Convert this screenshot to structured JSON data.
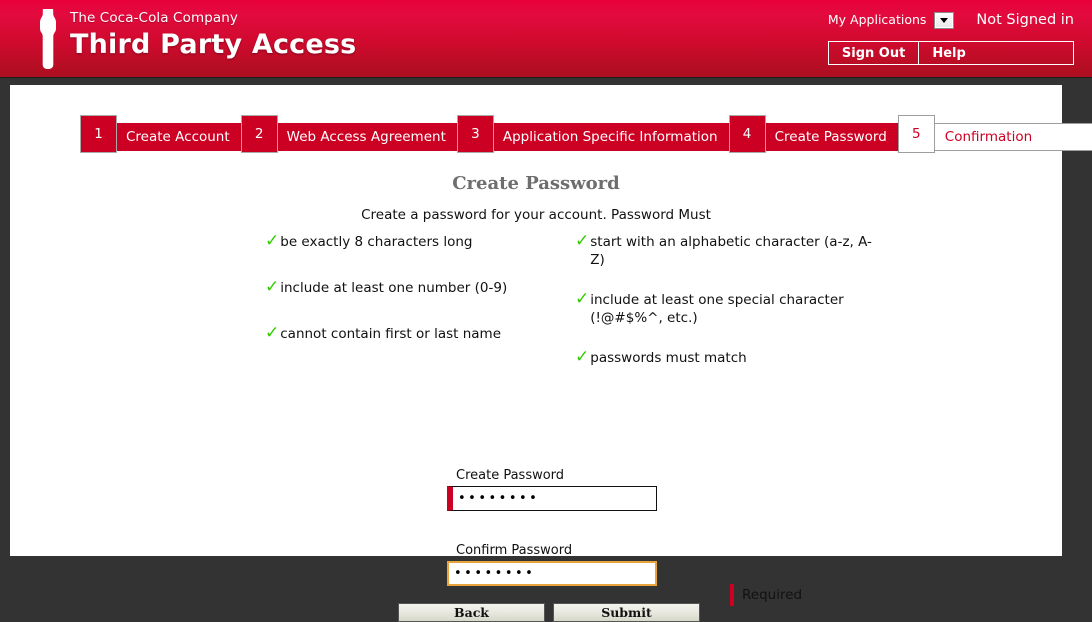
{
  "header": {
    "company": "The Coca-Cola Company",
    "app_title": "Third Party Access",
    "logo_icon": "coca-cola-bottle-icon",
    "apps_label": "My Applications",
    "apps_caret_icon": "chevron-down-icon",
    "sign_status": "Not Signed in",
    "sign_out_label": "Sign Out",
    "help_label": "Help",
    "brand_red": "#cc0022",
    "header_gradient_top": "#e8003c",
    "header_gradient_bottom": "#ab0f20"
  },
  "steps": [
    {
      "number": "1",
      "label": "Create Account",
      "state": "active"
    },
    {
      "number": "2",
      "label": "Web Access Agreement",
      "state": "active"
    },
    {
      "number": "3",
      "label": "Application Specific Information",
      "state": "active"
    },
    {
      "number": "4",
      "label": "Create Password",
      "state": "active"
    },
    {
      "number": "5",
      "label": "Confirmation",
      "state": "inactive"
    }
  ],
  "form": {
    "title": "Create Password",
    "subtitle": "Create a password for your account. Password Must",
    "check_icon": "green-check-icon",
    "check_color": "#33cc00",
    "requirements_left": [
      "be exactly 8 characters long",
      "include at least one number (0-9)",
      "cannot contain first or last name"
    ],
    "requirements_right": [
      "start with an alphabetic character (a-z, A-Z)",
      "include at least one special character (!@#$%^, etc.)",
      "passwords must match"
    ],
    "create_password": {
      "label": "Create Password",
      "value": "••••••••",
      "placeholder": "",
      "border_color": "#111111",
      "required_marker_color": "#cc0022"
    },
    "confirm_password": {
      "label": "Confirm Password",
      "value": "••••••••",
      "placeholder": "",
      "border_color": "#e8a33d"
    },
    "back_label": "Back",
    "submit_label": "Submit",
    "required_legend": "Required"
  }
}
